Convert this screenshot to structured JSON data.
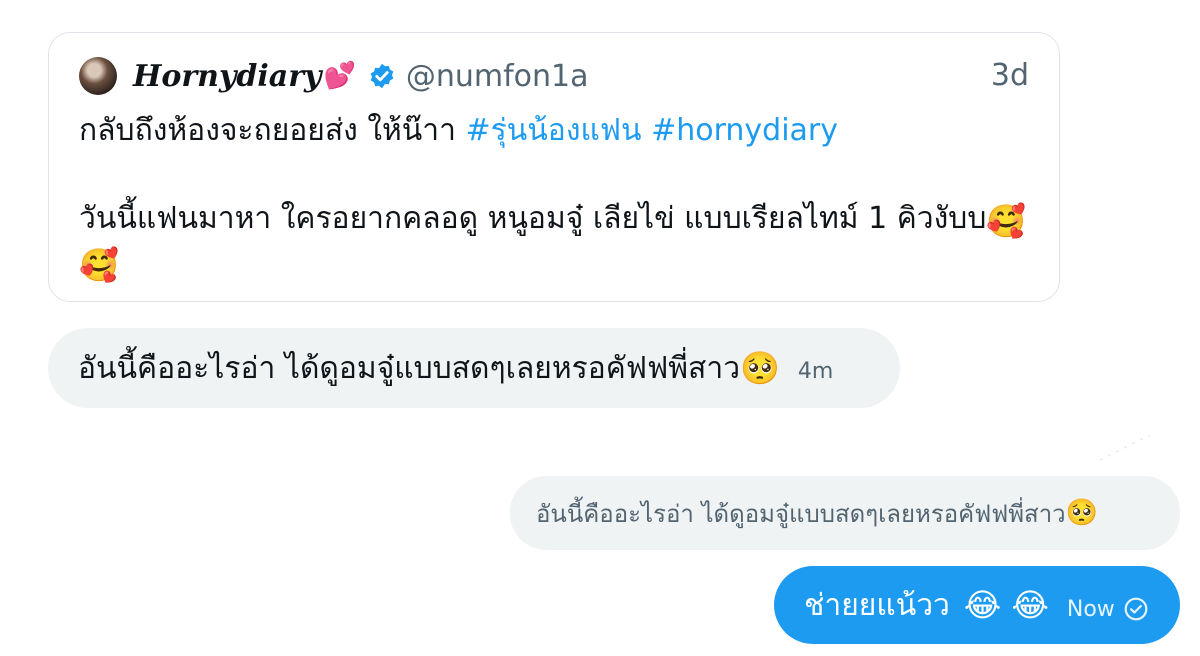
{
  "quote": {
    "display_name": "Hornydiary",
    "name_emoji": "💕",
    "verified_icon": "verified-badge-icon",
    "handle": "@numfon1a",
    "time": "3d",
    "line1_text": "กลับถึงห้องจะถยอยส่ง ให้น๊าา ",
    "hashtag1": "#รุ่นน้องแฟน",
    "hashtag2": "#hornydiary",
    "line2_text": "วันนี้แฟนมาหา ใครอยากคลอดู หนูอมจู๋ เลียไข่ แบบเรียลไทม์ 1 คิวงับบ",
    "line2_emoji": "🥰",
    "line3_emoji": "🥰",
    "colors": {
      "hashtag": "#1d9bf0",
      "verified": "#1d9bf0"
    }
  },
  "received": {
    "text": "อันนี้คืออะไรอ่า ได้ดูอมจู๋แบบสดๆเลยหรอคัฟฟพี่สาว",
    "emoji": "🥺",
    "time": "4m"
  },
  "reply_preview": {
    "text": "อันนี้คืออะไรอ่า ได้ดูอมจู๋แบบสดๆเลยหรอคัฟฟพี่สาว",
    "emoji": "🥺"
  },
  "sent": {
    "text": "ช่ายยแน้วว",
    "emojis": "😂 😂",
    "time": "Now",
    "status_icon": "seen-check-icon",
    "color": "#1d9bf0"
  }
}
